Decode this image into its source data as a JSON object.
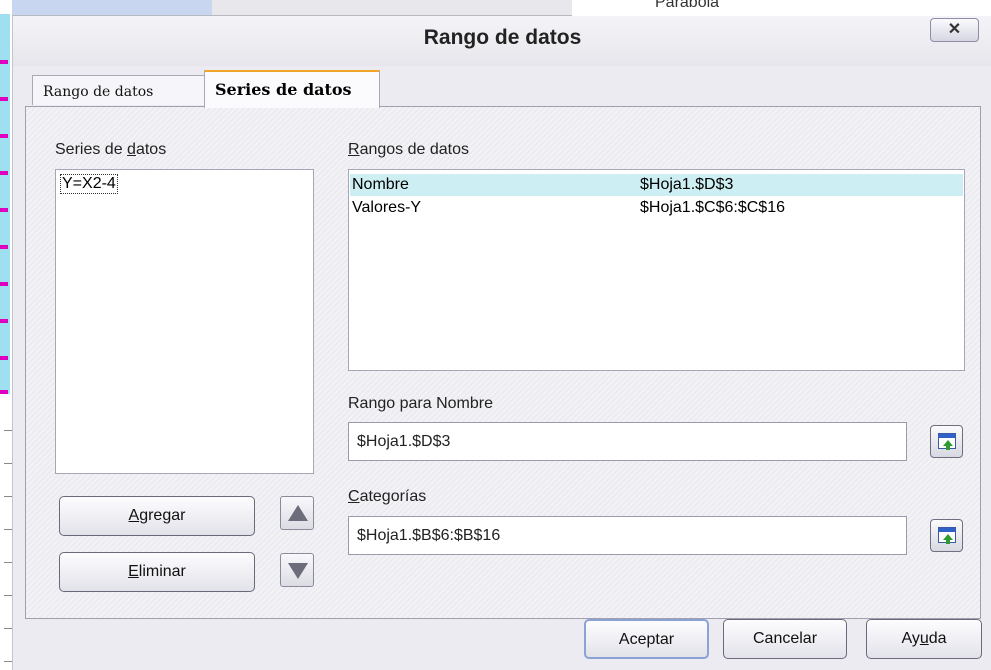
{
  "background": {
    "top_text": "Parabola"
  },
  "dialog": {
    "title": "Rango de datos",
    "close_label": "✕"
  },
  "tabs": [
    {
      "label": "Rango de datos",
      "active": false
    },
    {
      "label": "Series de datos",
      "active": true
    }
  ],
  "series_panel": {
    "label_prefix": "Series de ",
    "label_access": "d",
    "label_suffix": "atos",
    "items": [
      "Y=X2-4"
    ],
    "selected_index": 0
  },
  "ranges_panel": {
    "label_access": "R",
    "label_rest": "angos de datos",
    "rows": [
      {
        "role": "Nombre",
        "range": "$Hoja1.$D$3",
        "selected": true
      },
      {
        "role": "Valores-Y",
        "range": "$Hoja1.$C$6:$C$16",
        "selected": false
      }
    ]
  },
  "range_name": {
    "label": "Rango para Nombre",
    "value": "$Hoja1.$D$3"
  },
  "categories": {
    "label_access": "C",
    "label_rest": "ategorías",
    "value": "$Hoja1.$B$6:$B$16"
  },
  "buttons": {
    "add_access": "A",
    "add_rest": "gregar",
    "remove_access": "E",
    "remove_rest": "liminar",
    "ok": "Aceptar",
    "cancel": "Cancelar",
    "help_prefix": "Ay",
    "help_access": "u",
    "help_suffix": "da"
  },
  "colors": {
    "selected_row": "#cdeff3",
    "active_tab_accent": "#f0a52a",
    "dialog_bg": "#ecebf1"
  }
}
